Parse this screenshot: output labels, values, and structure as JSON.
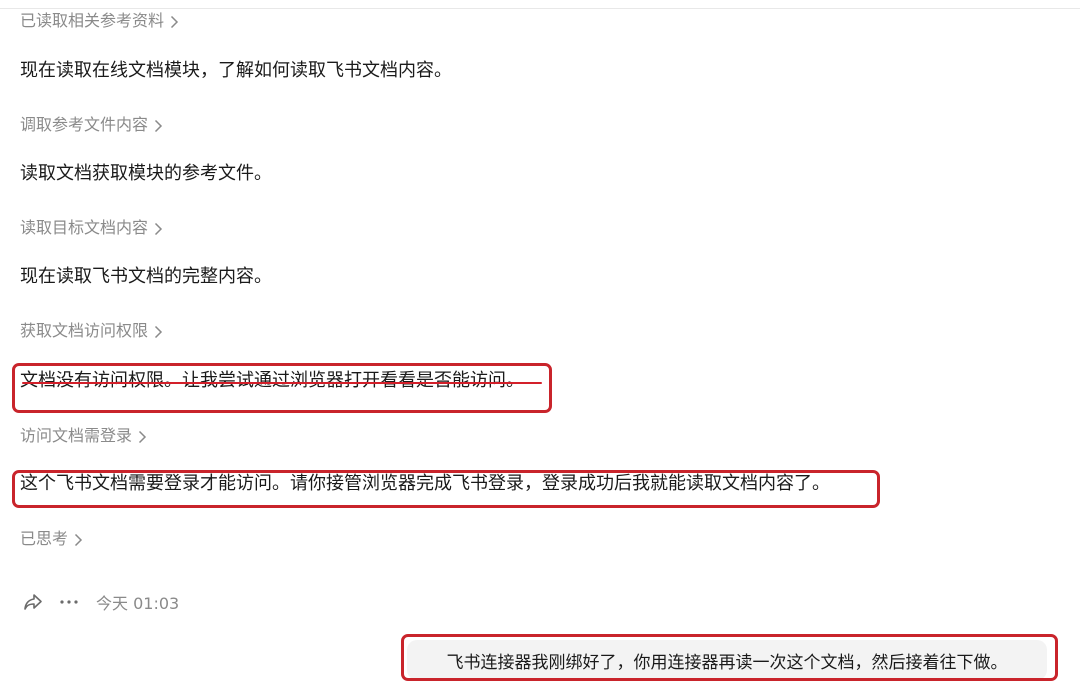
{
  "steps": [
    {
      "header": "已读取相关参考资料",
      "text": "现在读取在线文档模块，了解如何读取飞书文档内容。"
    },
    {
      "header": "调取参考文件内容",
      "text": "读取文档获取模块的参考文件。"
    },
    {
      "header": "读取目标文档内容",
      "text": "现在读取飞书文档的完整内容。"
    },
    {
      "header": "获取文档访问权限",
      "text": "文档没有访问权限。让我尝试通过浏览器打开看看是否能访问。"
    },
    {
      "header": "访问文档需登录",
      "text": "这个飞书文档需要登录才能访问。请你接管浏览器完成飞书登录，登录成功后我就能读取文档内容了。"
    }
  ],
  "thinking": {
    "label": "已思考"
  },
  "actions": {
    "timestamp": "今天 01:03",
    "share_icon": "share-icon",
    "more_icon": "more-icon"
  },
  "user_message": {
    "text": "飞书连接器我刚绑好了，你用连接器再读一次这个文档，然后接着往下做。"
  },
  "annotation_color": "#c9242b"
}
